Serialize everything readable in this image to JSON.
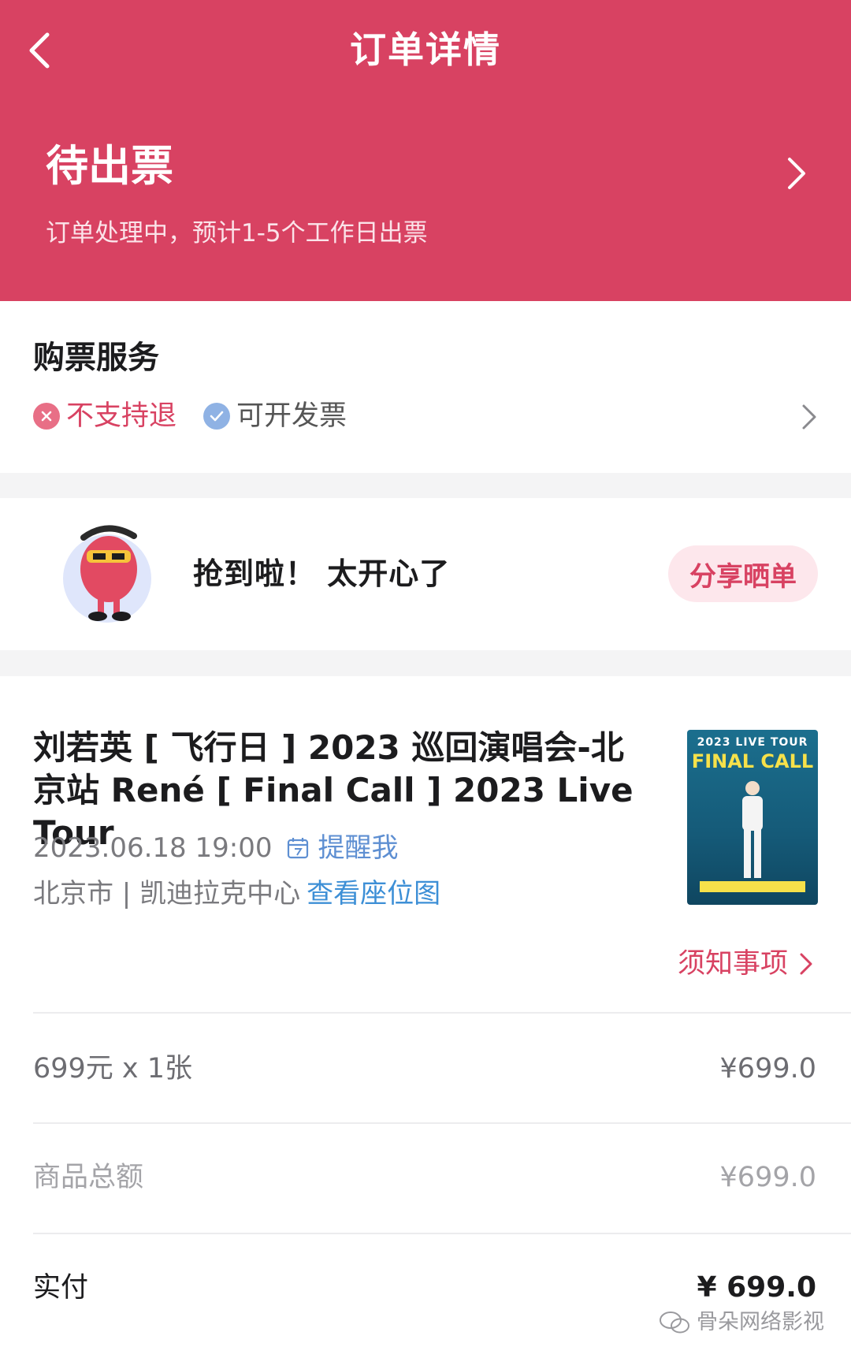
{
  "nav": {
    "title": "订单详情",
    "back_icon": "chevron-left-icon"
  },
  "status": {
    "title": "待出票",
    "description": "订单处理中，预计1-5个工作日出票",
    "chevron_icon": "chevron-right-icon"
  },
  "service": {
    "title": "购票服务",
    "tags": [
      {
        "label": "不支持退",
        "icon": "close-circle-icon",
        "color": "#d84262"
      },
      {
        "label": "可开发票",
        "icon": "check-circle-icon",
        "color": "#8fb2e4"
      }
    ],
    "chevron_icon": "chevron-right-icon"
  },
  "share": {
    "message": "抢到啦！  太开心了",
    "button_label": "分享晒单",
    "mascot_icon": "mascot-icon"
  },
  "event": {
    "title": "刘若英 [ 飞行日 ] 2023 巡回演唱会-北京站 René [ Final Call ] 2023 Live Tour",
    "datetime": "2023.06.18 19:00",
    "remind_label": "提醒我",
    "venue": "北京市 | 凯迪拉克中心",
    "seat_map_label": "查看座位图",
    "poster": {
      "line1": "2023 LIVE TOUR",
      "line2": "FINAL CALL"
    },
    "notice_label": "须知事项"
  },
  "pricing": {
    "ticket_line_label": "699元 x 1张",
    "ticket_line_value": "¥699.0",
    "subtotal_label": "商品总额",
    "subtotal_value": "¥699.0",
    "paid_label": "实付",
    "paid_value": "¥ 699.0"
  },
  "watermark": "骨朵网络影视",
  "colors": {
    "brand": "#d84262",
    "link": "#3d8fd6",
    "remind": "#5e8fd2",
    "page_bg": "#f4f4f5"
  }
}
